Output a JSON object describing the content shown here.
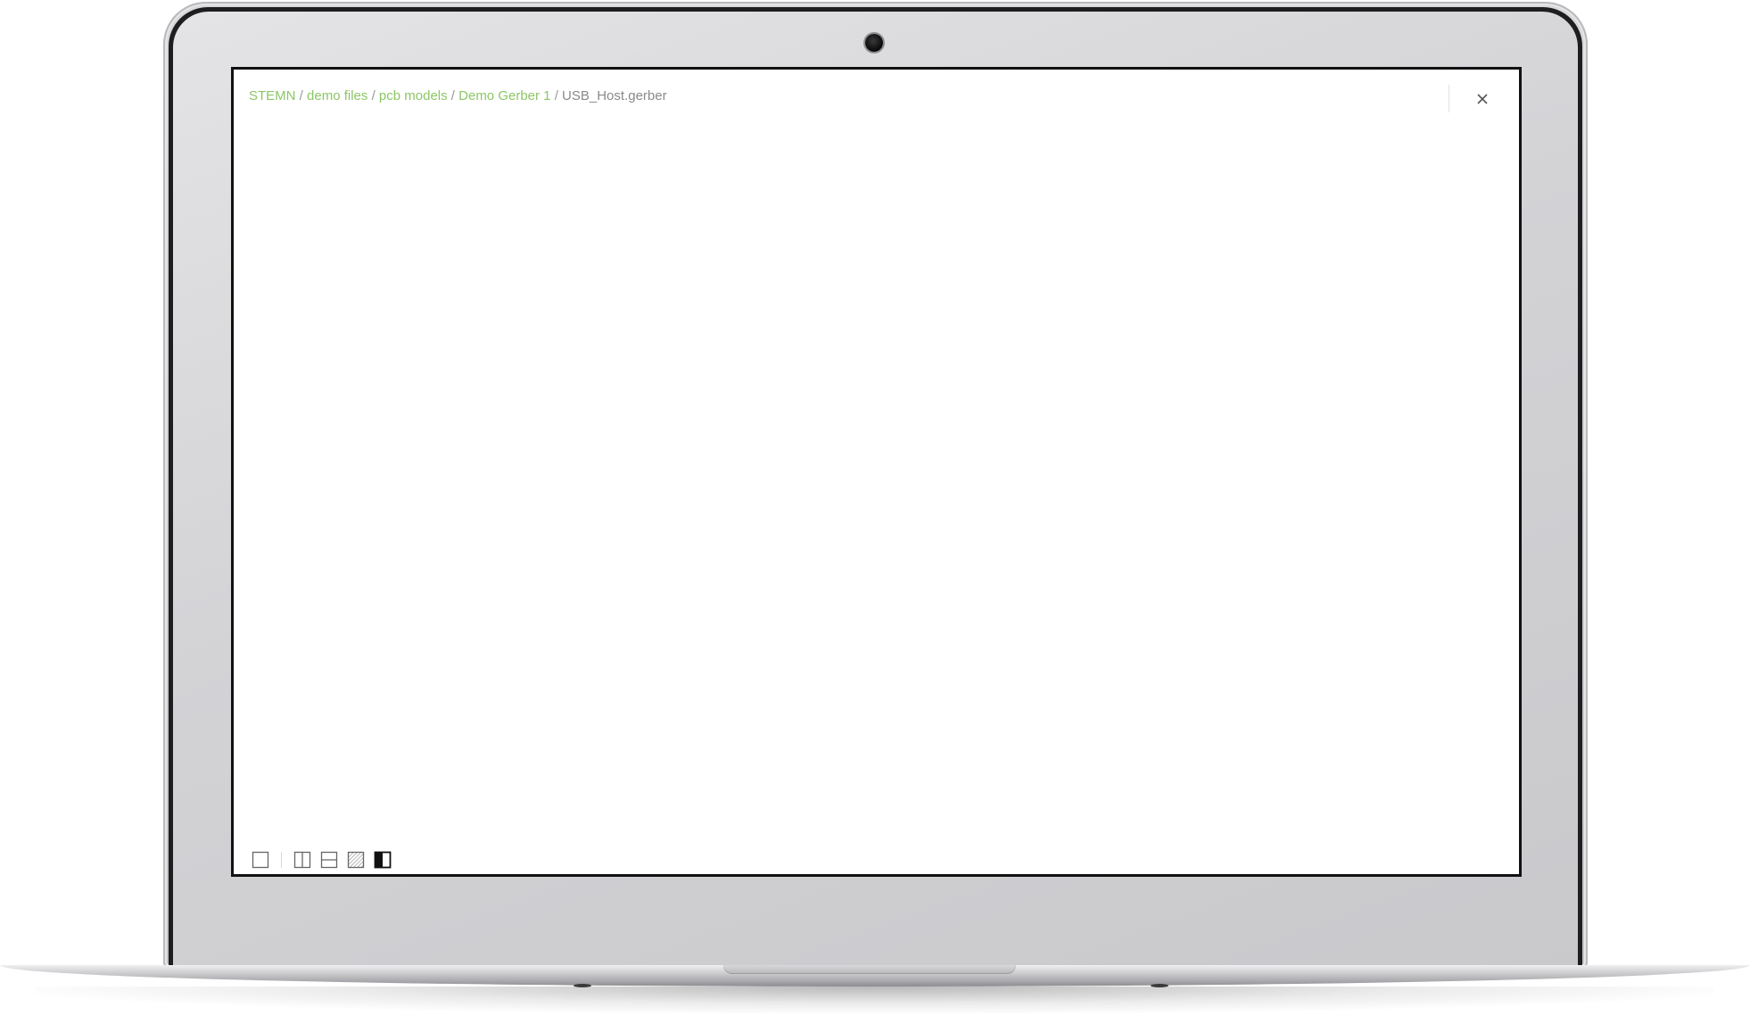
{
  "breadcrumb": {
    "items": [
      "STEMN",
      "demo files",
      "pcb models",
      "Demo Gerber 1"
    ],
    "separator": "/",
    "current": "USB_Host.gerber"
  },
  "header": {
    "close_icon": "close-icon"
  },
  "toolbar": {
    "tools": [
      {
        "name": "single-pane-icon"
      },
      {
        "name": "split-vertical-icon"
      },
      {
        "name": "split-horizontal-icon"
      },
      {
        "name": "overlay-hatch-icon"
      },
      {
        "name": "compare-half-icon"
      }
    ]
  },
  "colors": {
    "link": "#8cc665",
    "text_muted": "#8a8a8a",
    "screen_bg": "#ffffff"
  }
}
